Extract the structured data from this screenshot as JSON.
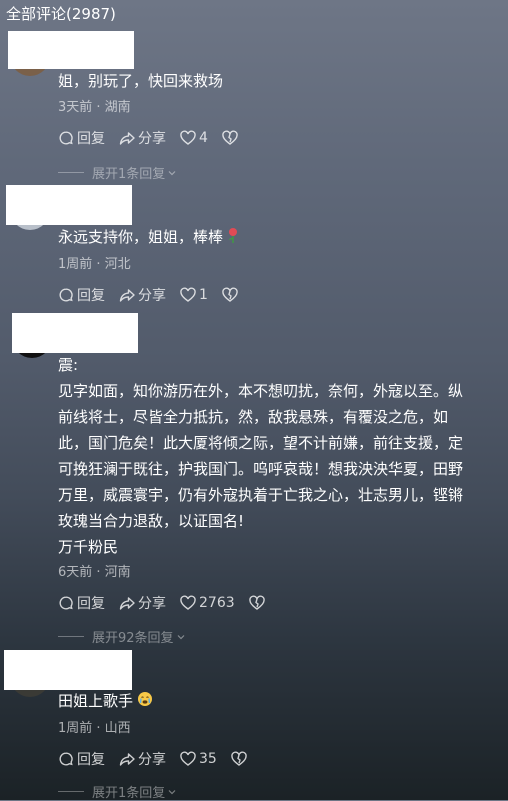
{
  "header": {
    "title": "全部评论(2987)"
  },
  "comments": [
    {
      "text": "姐，别玩了，快回来救场",
      "meta": "3天前 · 湖南",
      "reply": "回复",
      "share": "分享",
      "likes": "4",
      "expand": "展开1条回复"
    },
    {
      "text": "永远支持你，姐姐，棒棒",
      "meta": "1周前 · 河北",
      "reply": "回复",
      "share": "分享",
      "likes": "1",
      "emoji": "rose-icon"
    },
    {
      "text_lines": [
        "震:",
        "见字如面，知你游历在外，本不想叨扰，奈何，外寇以至。纵",
        "前线将士，尽皆全力抵抗，然，敌我悬殊，有覆没之危，如",
        "此，国门危矣！此大厦将倾之际，望不计前嫌，前往支援，定",
        "可挽狂澜于既往，护我国门。呜呼哀哉！想我泱泱华夏，田野",
        "万里，威震寰宇，仍有外寇执着于亡我之心，壮志男儿，铿锵",
        "玫瑰当合力退敌，以证国名!",
        "万千粉民"
      ],
      "meta": "6天前 · 河南",
      "reply": "回复",
      "share": "分享",
      "likes": "2763",
      "expand": "展开92条回复"
    },
    {
      "text": "田姐上歌手",
      "meta": "1周前 · 山西",
      "reply": "回复",
      "share": "分享",
      "likes": "35",
      "expand": "展开1条回复",
      "emoji": "crying-face-icon"
    }
  ]
}
